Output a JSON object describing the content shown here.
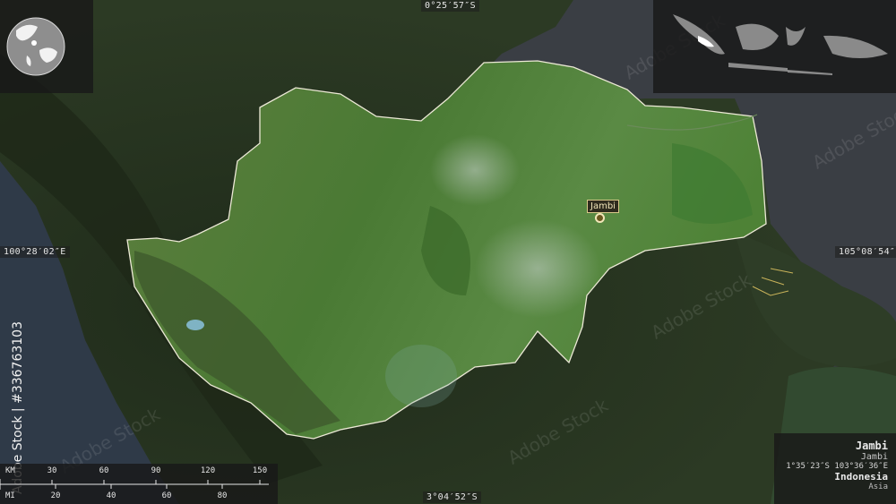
{
  "map": {
    "coordinates": {
      "top": "0°25′57″S",
      "bottom": "3°04′52″S",
      "left": "100°28′02″E",
      "right": "105°08′54″E"
    },
    "city": {
      "label": "Jambi"
    },
    "watermark_id": "Adobe Stock | #336763103",
    "stock_mark": "Adobe Stock"
  },
  "info_panel": {
    "region": "Jambi",
    "subregion": "Jambi",
    "coordinates": "1°35′23″S 103°36′36″E",
    "country": "Indonesia",
    "continent": "Asia"
  },
  "scale_bar": {
    "km_unit": "KM",
    "km_ticks": [
      "30",
      "60",
      "90",
      "120",
      "150"
    ],
    "mi_unit": "MI",
    "mi_ticks": [
      "20",
      "40",
      "60",
      "80"
    ]
  },
  "colors": {
    "water": "#3b3f45",
    "land_dark": "#27341f",
    "region_fill": "#4f7a36",
    "region_outline": "#e8e8d8",
    "city_marker": "#f1e6b8"
  }
}
